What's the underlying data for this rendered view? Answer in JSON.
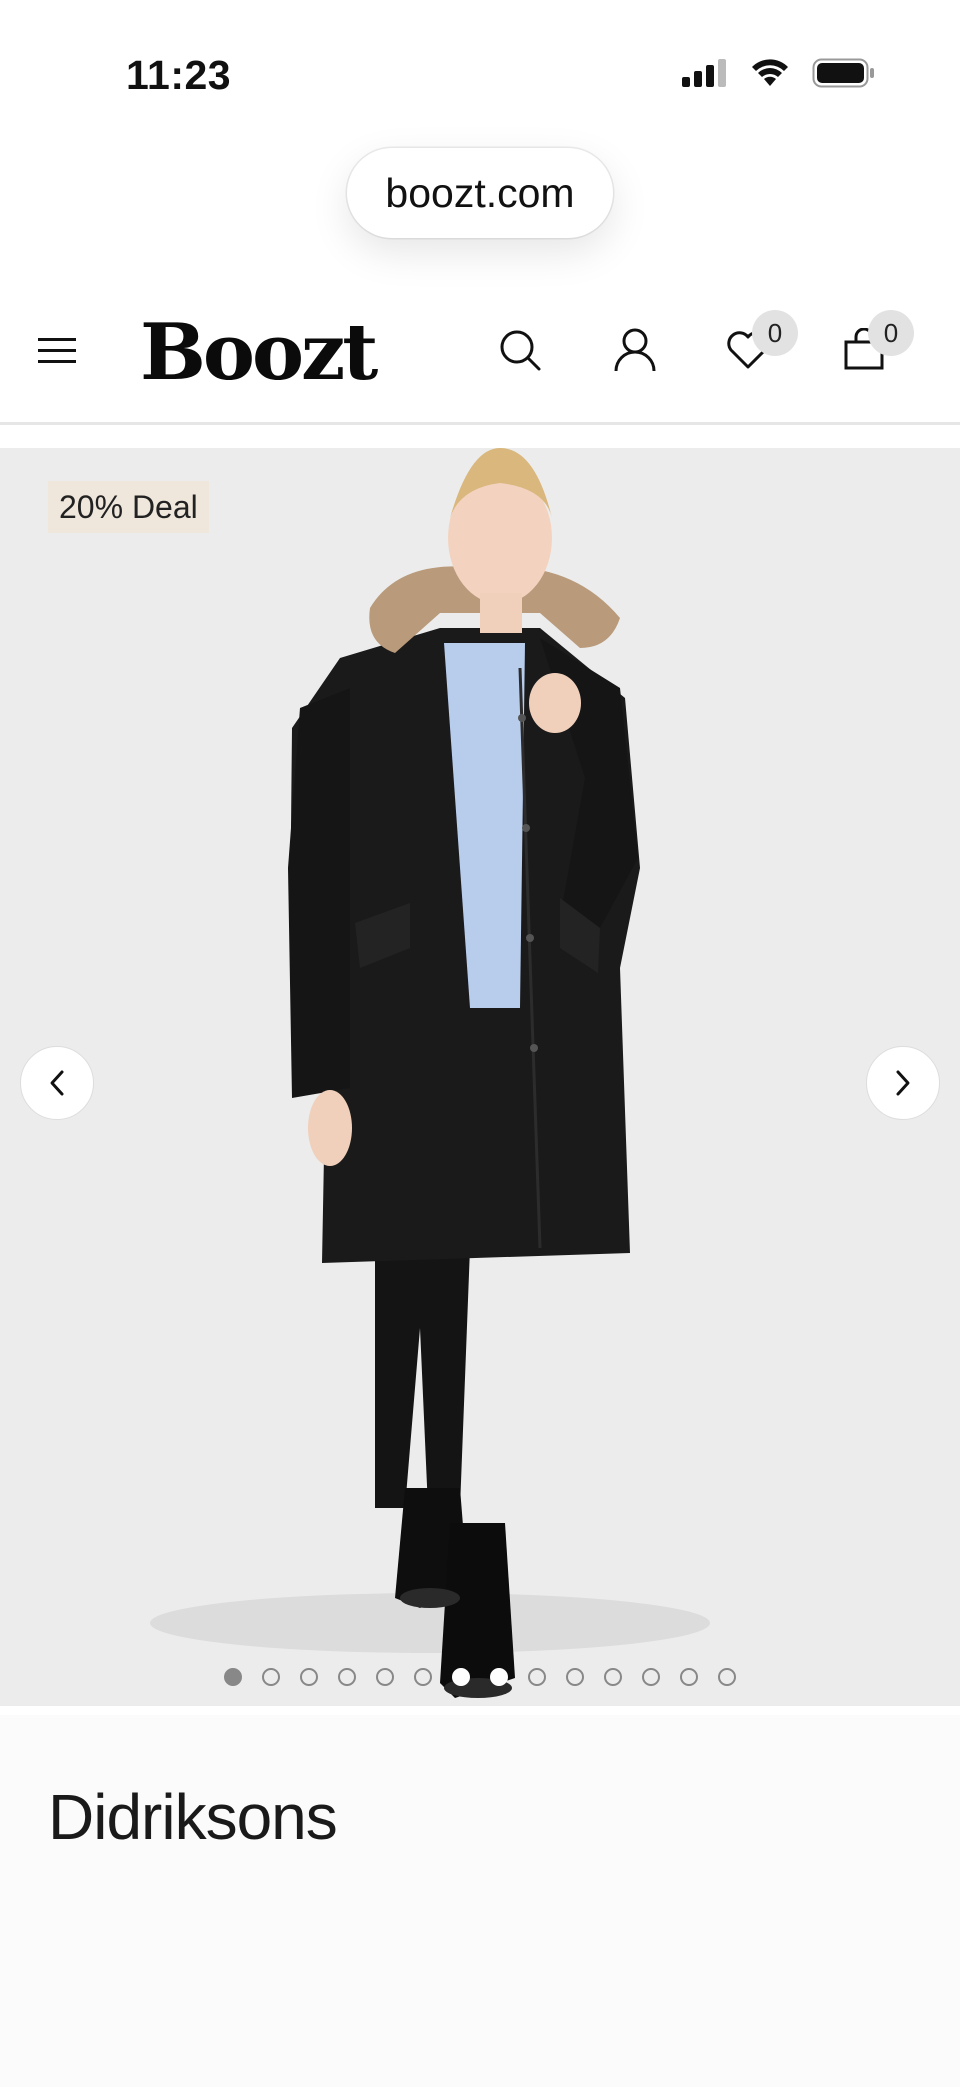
{
  "status_bar": {
    "time": "11:23"
  },
  "browser": {
    "url": "boozt.com"
  },
  "header": {
    "logo": "Boozt",
    "wishlist_count": "0",
    "cart_count": "0"
  },
  "gallery": {
    "badge": "20% Deal",
    "dot_count": 14,
    "active_index": 0
  },
  "product": {
    "brand": "Didriksons"
  },
  "icons": [
    "menu-icon",
    "search-icon",
    "account-icon",
    "heart-icon",
    "bag-icon",
    "chevron-left-icon",
    "chevron-right-icon",
    "signal-icon",
    "wifi-icon",
    "battery-icon"
  ]
}
